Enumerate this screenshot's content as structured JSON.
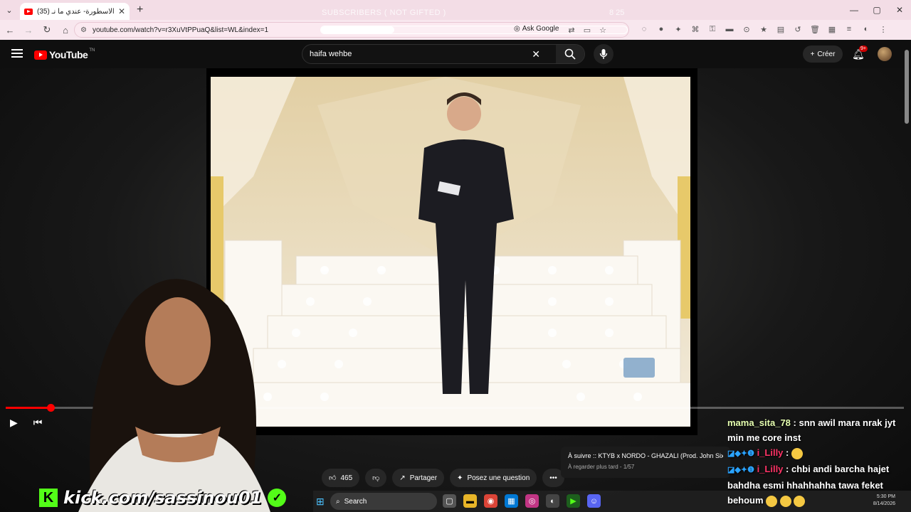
{
  "browser": {
    "tab_title": "(35) الحلقة الاسطورة- عندي ما نـ",
    "overlay_text": "SUBSCRIBERS ( NOT GIFTED )",
    "overlay_count": "8 25",
    "url": "youtube.com/watch?v=r3XuVtPPuaQ&list=WL&index=1",
    "progress_fraction": 0.24,
    "ask_google": "Ask Google"
  },
  "youtube": {
    "logo_text": "YouTube",
    "logo_tm": "TN",
    "search_value": "haifa wehbe",
    "create_label": "Créer",
    "notif_badge": "9+",
    "progress_fraction": 0.05,
    "likes": "465",
    "share_label": "Partager",
    "ask_label": "Posez une question",
    "upnext_title": "À suivre :: KTYB x NORDO - GHAZALI (Prod. John Six)",
    "upnext_sub": "À regarder plus tard - 1/57"
  },
  "stream": {
    "kick_url": "kick.com/sassinou01"
  },
  "chat": [
    {
      "user": "mama_sita_78",
      "text": "snn awil mara nrak jyt min me core inst",
      "color": "#e6ffb0"
    },
    {
      "user": "i_Lilly",
      "text": "",
      "color": "#ff3366",
      "emoji": true
    },
    {
      "user": "i_Lilly",
      "text": "chbi andi barcha hajet bahdha esmi hhahhahha tawa feket behoum",
      "color": "#ff3366",
      "emoji": true
    }
  ],
  "taskbar": {
    "search_label": "Search",
    "time": "5:30 PM",
    "date": "8/14/2026"
  },
  "colors": {
    "accent": "#ff0000",
    "kick_green": "#53fc18",
    "tab_bg": "#f3dde6"
  }
}
